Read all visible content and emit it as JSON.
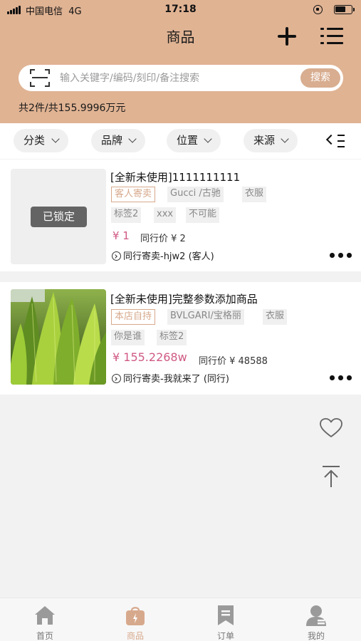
{
  "status_bar": {
    "carrier": "中国电信",
    "network": "4G",
    "time": "17:18"
  },
  "header": {
    "title": "商品",
    "add_icon": "plus-icon",
    "menu_icon": "list-menu-icon",
    "search": {
      "placeholder": "输入关键字/编码/刻印/备注搜索",
      "value": "",
      "button": "搜索",
      "scan_icon": "scan-icon"
    },
    "summary": "共2件/共155.9996万元"
  },
  "filters": {
    "chips": [
      {
        "label": "分类"
      },
      {
        "label": "品牌"
      },
      {
        "label": "位置"
      },
      {
        "label": "来源"
      }
    ],
    "more_icon": "collapse-menu-icon"
  },
  "products": [
    {
      "title": "[全新未使用]1111111111",
      "locked_label": "已锁定",
      "tags": [
        "客人寄卖",
        "Gucci /古驰",
        "衣服",
        "标签2",
        "xxx",
        "不可能"
      ],
      "price": "¥ 1",
      "peer_price": "同行价 ¥ 2",
      "source": "同行寄卖-hjw2 (客人)"
    },
    {
      "title": "[全新未使用]完整参数添加商品",
      "tags": [
        "本店自持",
        "BVLGARI/宝格丽",
        "衣服",
        "你是谁",
        "标签2"
      ],
      "price": "¥ 155.2268w",
      "peer_price": "同行价 ¥ 48588",
      "source": "同行寄卖-我就来了 (同行)"
    }
  ],
  "floating": {
    "favorite_icon": "heart-icon",
    "top_icon": "back-to-top-icon"
  },
  "tabbar": {
    "tabs": [
      {
        "label": "首页",
        "icon": "home-icon"
      },
      {
        "label": "商品",
        "icon": "bag-icon",
        "active": true
      },
      {
        "label": "订单",
        "icon": "bookmark-icon"
      },
      {
        "label": "我的",
        "icon": "user-icon"
      }
    ]
  },
  "colors": {
    "header_bg": "#e0b393",
    "accent": "#d7a98c",
    "price": "#d05a84"
  }
}
